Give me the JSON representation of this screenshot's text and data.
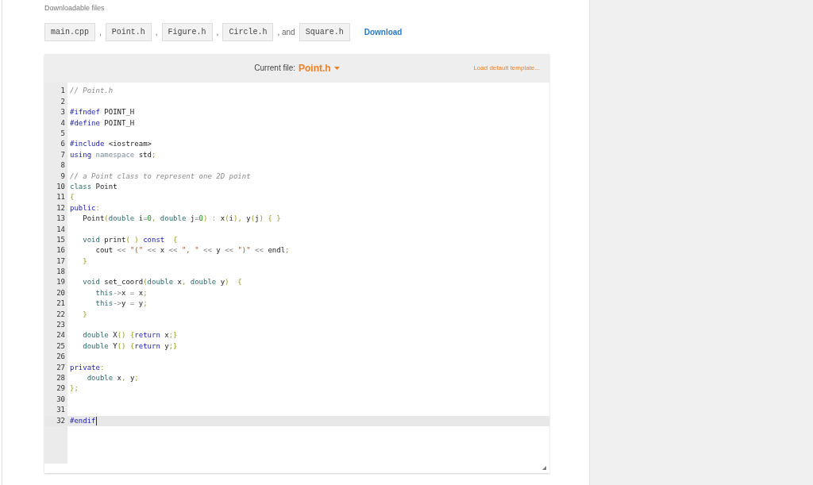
{
  "downloads": {
    "label": "Downloadable files",
    "files": [
      {
        "name": "main.cpp",
        "separator": ","
      },
      {
        "name": "Point.h",
        "separator": ","
      },
      {
        "name": "Figure.h",
        "separator": ","
      },
      {
        "name": "Circle.h",
        "separator": ", and"
      },
      {
        "name": "Square.h"
      }
    ],
    "download_link": "Download"
  },
  "editor": {
    "current_file_label": "Current file:",
    "current_file": "Point.h",
    "load_template": "Load default template...",
    "lines": [
      {
        "number": "1",
        "active": false,
        "tokens": [
          {
            "kind": "comment",
            "text": "// Point.h"
          }
        ]
      },
      {
        "number": "2",
        "active": false
      },
      {
        "number": "3",
        "active": false,
        "tokens": [
          {
            "kind": "keyword",
            "text": "#ifndef"
          },
          {
            "kind": "plain",
            "text": " POINT_H"
          }
        ]
      },
      {
        "number": "4",
        "active": false,
        "tokens": [
          {
            "kind": "keyword",
            "text": "#define"
          },
          {
            "kind": "plain",
            "text": " POINT_H"
          }
        ]
      },
      {
        "number": "5",
        "active": false
      },
      {
        "number": "6",
        "active": false,
        "tokens": [
          {
            "kind": "keyword",
            "text": "#include"
          },
          {
            "kind": "plain",
            "text": " <iostream>"
          }
        ]
      },
      {
        "number": "7",
        "active": false,
        "tokens": [
          {
            "kind": "keyword",
            "text": "using"
          },
          {
            "kind": "muted",
            "text": " namespace"
          },
          {
            "kind": "plain",
            "text": " std"
          },
          {
            "kind": "punct",
            "text": ";"
          }
        ]
      },
      {
        "number": "8",
        "active": false
      },
      {
        "number": "9",
        "active": false,
        "tokens": [
          {
            "kind": "comment",
            "text": "// a Point class to represent one 2D point"
          }
        ]
      },
      {
        "number": "10",
        "active": false,
        "tokens": [
          {
            "kind": "type",
            "text": "class"
          },
          {
            "kind": "plain",
            "text": " Point"
          }
        ]
      },
      {
        "number": "11",
        "active": false,
        "tokens": [
          {
            "kind": "punct",
            "text": "{"
          }
        ]
      },
      {
        "number": "12",
        "active": false,
        "tokens": [
          {
            "kind": "keyword",
            "text": "public"
          },
          {
            "kind": "punct",
            "text": ":"
          }
        ]
      },
      {
        "number": "13",
        "active": false,
        "tokens": [
          {
            "kind": "plain",
            "text": "   Point"
          },
          {
            "kind": "punct",
            "text": "("
          },
          {
            "kind": "type",
            "text": "double"
          },
          {
            "kind": "plain",
            "text": " i"
          },
          {
            "kind": "op",
            "text": "="
          },
          {
            "kind": "number",
            "text": "0"
          },
          {
            "kind": "punct",
            "text": ", "
          },
          {
            "kind": "type",
            "text": "double"
          },
          {
            "kind": "plain",
            "text": " j"
          },
          {
            "kind": "op",
            "text": "="
          },
          {
            "kind": "number",
            "text": "0"
          },
          {
            "kind": "punct",
            "text": ")"
          },
          {
            "kind": "op",
            "text": " : "
          },
          {
            "kind": "plain",
            "text": "x"
          },
          {
            "kind": "punct",
            "text": "("
          },
          {
            "kind": "plain",
            "text": "i"
          },
          {
            "kind": "punct",
            "text": "), "
          },
          {
            "kind": "plain",
            "text": "y"
          },
          {
            "kind": "punct",
            "text": "("
          },
          {
            "kind": "plain",
            "text": "j"
          },
          {
            "kind": "punct",
            "text": ") { }"
          }
        ]
      },
      {
        "number": "14",
        "active": false
      },
      {
        "number": "15",
        "active": false,
        "tokens": [
          {
            "kind": "type",
            "text": "   void"
          },
          {
            "kind": "plain",
            "text": " print"
          },
          {
            "kind": "punct",
            "text": "( )"
          },
          {
            "kind": "keyword",
            "text": " const"
          },
          {
            "kind": "punct",
            "text": "  {"
          }
        ]
      },
      {
        "number": "16",
        "active": false,
        "tokens": [
          {
            "kind": "plain",
            "text": "      cout"
          },
          {
            "kind": "op",
            "text": " << "
          },
          {
            "kind": "string",
            "text": "\"(\""
          },
          {
            "kind": "op",
            "text": " << "
          },
          {
            "kind": "plain",
            "text": "x"
          },
          {
            "kind": "op",
            "text": " << "
          },
          {
            "kind": "string",
            "text": "\", \""
          },
          {
            "kind": "op",
            "text": " << "
          },
          {
            "kind": "plain",
            "text": "y"
          },
          {
            "kind": "op",
            "text": " << "
          },
          {
            "kind": "string",
            "text": "\")\""
          },
          {
            "kind": "op",
            "text": " << "
          },
          {
            "kind": "plain",
            "text": "endl"
          },
          {
            "kind": "punct",
            "text": ";"
          }
        ]
      },
      {
        "number": "17",
        "active": false,
        "tokens": [
          {
            "kind": "punct",
            "text": "   }"
          }
        ]
      },
      {
        "number": "18",
        "active": false
      },
      {
        "number": "19",
        "active": false,
        "tokens": [
          {
            "kind": "type",
            "text": "   void"
          },
          {
            "kind": "plain",
            "text": " set_coord"
          },
          {
            "kind": "punct",
            "text": "("
          },
          {
            "kind": "type",
            "text": "double"
          },
          {
            "kind": "plain",
            "text": " x"
          },
          {
            "kind": "punct",
            "text": ", "
          },
          {
            "kind": "type",
            "text": "double"
          },
          {
            "kind": "plain",
            "text": " y"
          },
          {
            "kind": "punct",
            "text": ")  {"
          }
        ]
      },
      {
        "number": "20",
        "active": false,
        "tokens": [
          {
            "kind": "type",
            "text": "      this"
          },
          {
            "kind": "op",
            "text": "->"
          },
          {
            "kind": "plain",
            "text": "x"
          },
          {
            "kind": "op",
            "text": " = "
          },
          {
            "kind": "plain",
            "text": "x"
          },
          {
            "kind": "punct",
            "text": ";"
          }
        ]
      },
      {
        "number": "21",
        "active": false,
        "tokens": [
          {
            "kind": "type",
            "text": "      this"
          },
          {
            "kind": "op",
            "text": "->"
          },
          {
            "kind": "plain",
            "text": "y"
          },
          {
            "kind": "op",
            "text": " = "
          },
          {
            "kind": "plain",
            "text": "y"
          },
          {
            "kind": "punct",
            "text": ";"
          }
        ]
      },
      {
        "number": "22",
        "active": false,
        "tokens": [
          {
            "kind": "punct",
            "text": "   }"
          }
        ]
      },
      {
        "number": "23",
        "active": false
      },
      {
        "number": "24",
        "active": false,
        "tokens": [
          {
            "kind": "type",
            "text": "   double"
          },
          {
            "kind": "plain",
            "text": " X"
          },
          {
            "kind": "punct",
            "text": "() {"
          },
          {
            "kind": "keyword",
            "text": "return"
          },
          {
            "kind": "plain",
            "text": " x"
          },
          {
            "kind": "punct",
            "text": ";}"
          }
        ]
      },
      {
        "number": "25",
        "active": false,
        "tokens": [
          {
            "kind": "type",
            "text": "   double"
          },
          {
            "kind": "plain",
            "text": " Y"
          },
          {
            "kind": "punct",
            "text": "() {"
          },
          {
            "kind": "keyword",
            "text": "return"
          },
          {
            "kind": "plain",
            "text": " y"
          },
          {
            "kind": "punct",
            "text": ";}"
          }
        ]
      },
      {
        "number": "26",
        "active": false
      },
      {
        "number": "27",
        "active": false,
        "tokens": [
          {
            "kind": "keyword",
            "text": "private"
          },
          {
            "kind": "punct",
            "text": ":"
          }
        ]
      },
      {
        "number": "28",
        "active": false,
        "tokens": [
          {
            "kind": "type",
            "text": "    double"
          },
          {
            "kind": "plain",
            "text": " x"
          },
          {
            "kind": "punct",
            "text": ", "
          },
          {
            "kind": "plain",
            "text": "y"
          },
          {
            "kind": "punct",
            "text": ";"
          }
        ]
      },
      {
        "number": "29",
        "active": false,
        "tokens": [
          {
            "kind": "punct",
            "text": "};"
          }
        ]
      },
      {
        "number": "30",
        "active": false
      },
      {
        "number": "31",
        "active": false
      },
      {
        "number": "32",
        "active": true,
        "tokens": [
          {
            "kind": "keyword",
            "text": "#endif"
          }
        ]
      }
    ]
  }
}
